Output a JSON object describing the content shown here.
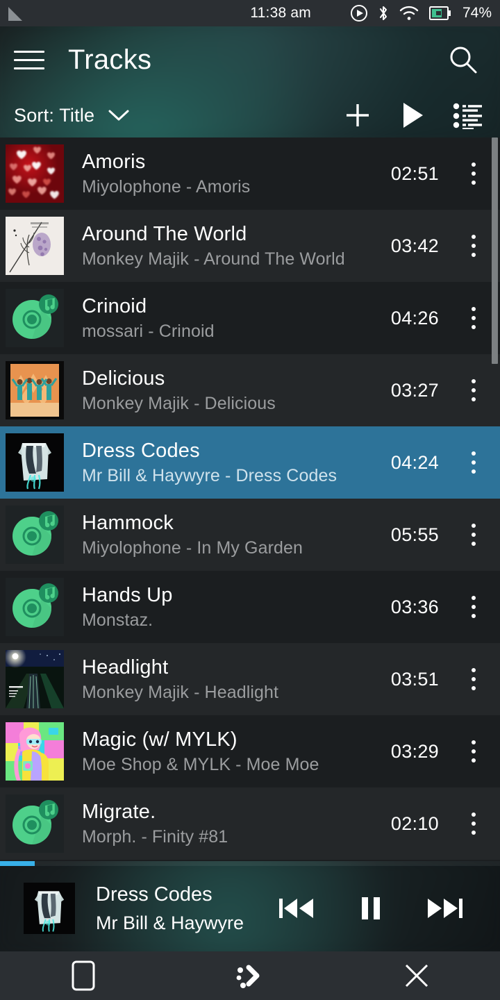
{
  "statusbar": {
    "signal_icon": "signal-triangle-icon",
    "time": "11:38 am",
    "icons": [
      "play-circle-icon",
      "bluetooth-icon",
      "wifi-icon",
      "battery-icon"
    ],
    "battery_percent": "74%"
  },
  "header": {
    "menu_icon": "hamburger-menu-icon",
    "title": "Tracks",
    "search_icon": "search-icon",
    "sort_label": "Sort: Title",
    "sort_chevron_icon": "chevron-down-icon",
    "add_icon": "plus-icon",
    "play_icon": "play-icon",
    "queue_icon": "queue-list-icon",
    "accent_color": "#2d7399",
    "backdrop_color": "#1d2b2c"
  },
  "tracks": [
    {
      "title": "Amoris",
      "subtitle": "Miyolophone - Amoris",
      "duration": "02:51",
      "art": "hearts",
      "selected": false,
      "menu_icon": "overflow-menu-icon"
    },
    {
      "title": "Around The World",
      "subtitle": "Monkey Majik - Around The World",
      "duration": "03:42",
      "art": "flower",
      "selected": false,
      "menu_icon": "overflow-menu-icon"
    },
    {
      "title": "Crinoid",
      "subtitle": "mossari - Crinoid",
      "duration": "04:26",
      "art": "placeholder",
      "selected": false,
      "menu_icon": "overflow-menu-icon"
    },
    {
      "title": "Delicious",
      "subtitle": "Monkey Majik - Delicious",
      "duration": "03:27",
      "art": "dancers",
      "selected": false,
      "menu_icon": "overflow-menu-icon"
    },
    {
      "title": "Dress Codes",
      "subtitle": "Mr Bill & Haywyre - Dress Codes",
      "duration": "04:24",
      "art": "dress",
      "selected": true,
      "menu_icon": "overflow-menu-icon"
    },
    {
      "title": "Hammock",
      "subtitle": "Miyolophone - In My Garden",
      "duration": "05:55",
      "art": "placeholder",
      "selected": false,
      "menu_icon": "overflow-menu-icon"
    },
    {
      "title": "Hands Up",
      "subtitle": "Monstaz.",
      "duration": "03:36",
      "art": "placeholder",
      "selected": false,
      "menu_icon": "overflow-menu-icon"
    },
    {
      "title": "Headlight",
      "subtitle": "Monkey Majik - Headlight",
      "duration": "03:51",
      "art": "night",
      "selected": false,
      "menu_icon": "overflow-menu-icon"
    },
    {
      "title": "Magic (w/ MYLK)",
      "subtitle": "Moe Shop & MYLK - Moe Moe",
      "duration": "03:29",
      "art": "anime",
      "selected": false,
      "menu_icon": "overflow-menu-icon"
    },
    {
      "title": "Migrate.",
      "subtitle": "Morph. - Finity #81",
      "duration": "02:10",
      "art": "placeholder",
      "selected": false,
      "menu_icon": "overflow-menu-icon"
    }
  ],
  "nowplaying": {
    "title": "Dress Codes",
    "artist": "Mr Bill & Haywyre",
    "art": "dress",
    "progress_percent": 7,
    "progress_color": "#38b0e8",
    "prev_icon": "skip-previous-icon",
    "playpause_icon": "pause-icon",
    "next_icon": "skip-next-icon"
  },
  "navbar": {
    "items": [
      {
        "icon": "app-window-icon"
      },
      {
        "icon": "ubuntu-logo-icon"
      },
      {
        "icon": "close-icon"
      }
    ]
  }
}
